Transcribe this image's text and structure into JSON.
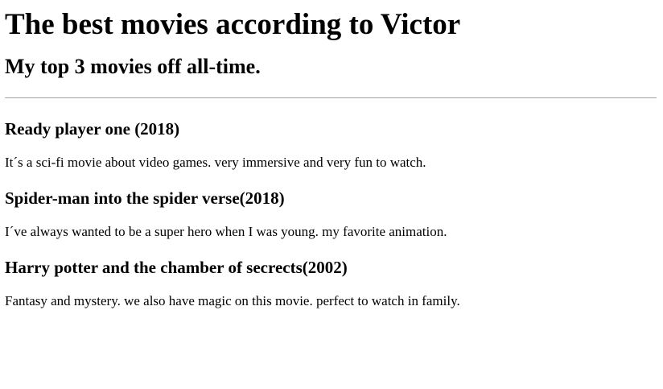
{
  "page": {
    "title": "The best movies according to Victor",
    "subtitle": "My top 3 movies off all-time."
  },
  "movies": [
    {
      "title": "Ready player one (2018)",
      "description": "It´s a sci-fi movie about video games. very immersive and very fun to watch."
    },
    {
      "title": "Spider-man into the spider verse(2018)",
      "description": "I´ve always wanted to be a super hero when I was young. my favorite animation."
    },
    {
      "title": "Harry potter and the chamber of secrects(2002)",
      "description": "Fantasy and mystery. we also have magic on this movie. perfect to watch in family."
    }
  ]
}
